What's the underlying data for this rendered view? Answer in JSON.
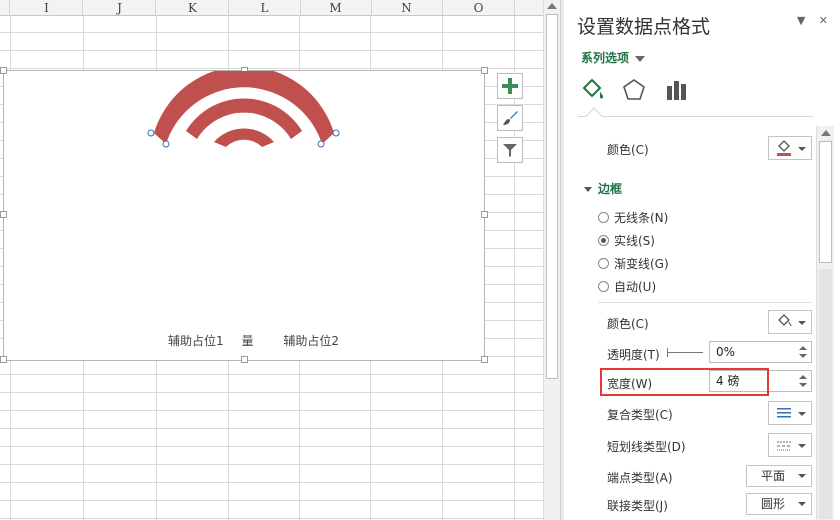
{
  "sheet": {
    "columns": [
      "I",
      "J",
      "K",
      "L",
      "M",
      "N",
      "O"
    ]
  },
  "chart": {
    "legend": {
      "item1": "辅助占位1",
      "item2": "量",
      "item3": "辅助占位2"
    },
    "arc_color": "#c0504d"
  },
  "chart_tools": {
    "add_element": "chart-elements-plus-icon",
    "style": "chart-styles-brush-icon",
    "filter": "chart-filter-icon"
  },
  "pane": {
    "title": "设置数据点格式",
    "series_options": "系列选项",
    "fill_color_label": "颜色(C)",
    "fill_color": "#c0504d",
    "border_section": "边框",
    "border_options": {
      "none": "无线条(N)",
      "solid": "实线(S)",
      "gradient": "渐变线(G)",
      "auto": "自动(U)"
    },
    "border_color_label": "颜色(C)",
    "transparency_label": "透明度(T)",
    "transparency_value": "0%",
    "width_label": "宽度(W)",
    "width_value": "4 磅",
    "compound_label": "复合类型(C)",
    "dash_label": "短划线类型(D)",
    "cap_label": "端点类型(A)",
    "cap_value": "平面",
    "join_label": "联接类型(J)",
    "join_value": "圆形"
  }
}
